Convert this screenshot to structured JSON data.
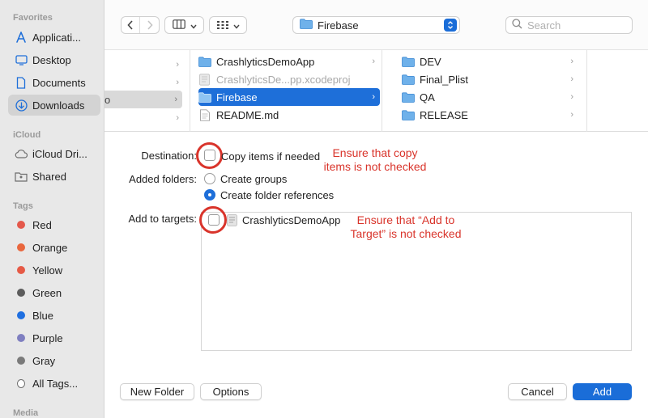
{
  "sidebar": {
    "favorites_heading": "Favorites",
    "favorites": [
      {
        "label": "Applicati...",
        "icon": "applications-icon"
      },
      {
        "label": "Desktop",
        "icon": "desktop-icon"
      },
      {
        "label": "Documents",
        "icon": "document-icon"
      },
      {
        "label": "Downloads",
        "icon": "downloads-icon",
        "active": true
      }
    ],
    "icloud_heading": "iCloud",
    "icloud": [
      {
        "label": "iCloud Dri...",
        "icon": "cloud-icon"
      },
      {
        "label": "Shared",
        "icon": "shared-folder-icon"
      }
    ],
    "tags_heading": "Tags",
    "tags": [
      {
        "label": "Red",
        "color": "#e4584b"
      },
      {
        "label": "Orange",
        "color": "#e9673e"
      },
      {
        "label": "Yellow",
        "color": "#e65a46"
      },
      {
        "label": "Green",
        "color": "#5c5c5c"
      },
      {
        "label": "Blue",
        "color": "#1f6fe0"
      },
      {
        "label": "Purple",
        "color": "#7f7fc0"
      },
      {
        "label": "Gray",
        "color": "#7a7a7a"
      },
      {
        "label": "All Tags...",
        "color": ""
      }
    ],
    "media_heading": "Media"
  },
  "toolbar": {
    "back_icon": "chevron-left-icon",
    "forward_icon": "chevron-right-icon",
    "view_columns_icon": "columns-view-icon",
    "view_grid_icon": "grid-view-icon",
    "path_label": "Firebase",
    "search_placeholder": "Search"
  },
  "browser": {
    "col2": [
      {
        "label": "CrashlyticsDemoApp",
        "type": "folder",
        "chevron": true
      },
      {
        "label": "CrashlyticsDe...pp.xcodeproj",
        "type": "project",
        "dim": true
      },
      {
        "label": "Firebase",
        "type": "folder",
        "chevron": true,
        "selected": true
      },
      {
        "label": "README.md",
        "type": "file"
      }
    ],
    "col3": [
      {
        "label": "DEV",
        "type": "folder"
      },
      {
        "label": "Final_Plist",
        "type": "folder"
      },
      {
        "label": "QA",
        "type": "folder"
      },
      {
        "label": "RELEASE",
        "type": "folder"
      }
    ]
  },
  "options": {
    "destination_label": "Destination:",
    "copy_items_label": "Copy items if needed",
    "added_folders_label": "Added folders:",
    "create_groups_label": "Create groups",
    "create_folder_refs_label": "Create folder references",
    "add_to_targets_label": "Add to targets:",
    "target_name": "CrashlyticsDemoApp"
  },
  "annotations": {
    "copy_note_line1": "Ensure that copy",
    "copy_note_line2": "items is not checked",
    "target_note_line1": "Ensure that “Add to",
    "target_note_line2": "Target” is not checked"
  },
  "footer": {
    "new_folder": "New Folder",
    "options": "Options",
    "cancel": "Cancel",
    "add": "Add"
  },
  "colors": {
    "accent": "#1a6dd8",
    "annotation": "#d9342b"
  }
}
